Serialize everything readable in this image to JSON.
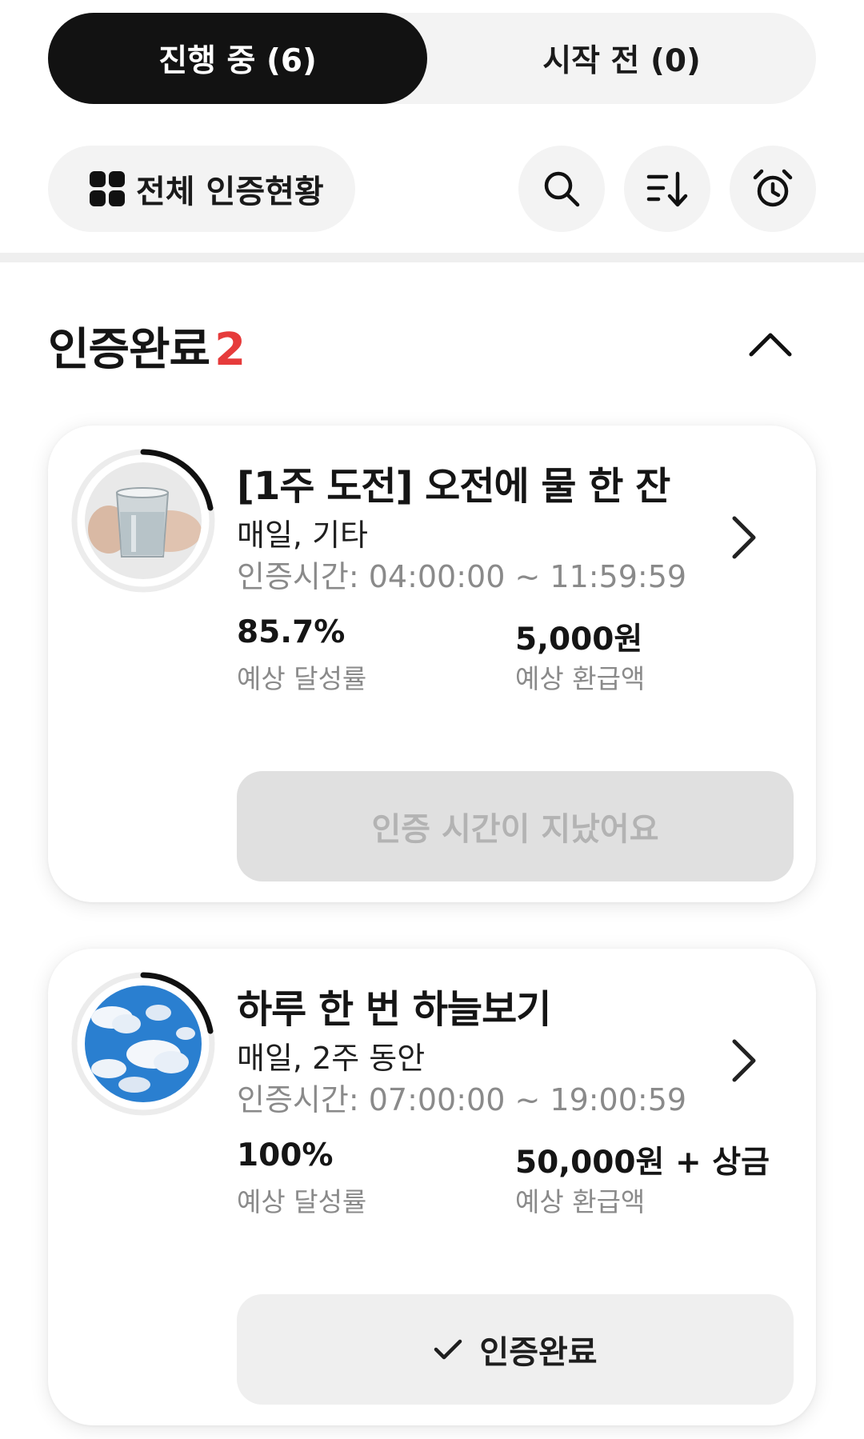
{
  "tabs": {
    "active_label": "진행 중 (6)",
    "inactive_label": "시작 전 (0)"
  },
  "toolbar": {
    "overview_label": "전체 인증현황",
    "icons": [
      "grid-icon",
      "search-icon",
      "sort-icon",
      "alarm-clock-icon"
    ]
  },
  "section": {
    "title": "인증완료",
    "count": "2",
    "count_color": "#e63b3b"
  },
  "cards": [
    {
      "title": "[1주 도전] 오전에 물 한 잔",
      "subtitle": "매일, 기타",
      "time": "인증시간: 04:00:00 ~ 11:59:59",
      "rate_value": "85.7%",
      "rate_label": "예상 달성률",
      "refund_value": "5,000원",
      "refund_label": "예상 환급액",
      "action_label": "인증 시간이 지났어요",
      "action_state": "disabled",
      "progress": 0.22
    },
    {
      "title": "하루 한 번 하늘보기",
      "subtitle": "매일, 2주 동안",
      "time": "인증시간: 07:00:00 ~ 19:00:59",
      "rate_value": "100%",
      "rate_label": "예상 달성률",
      "refund_value": "50,000원 + 상금",
      "refund_label": "예상 환급액",
      "action_label": "인증완료",
      "action_state": "done",
      "progress": 0.22
    }
  ]
}
